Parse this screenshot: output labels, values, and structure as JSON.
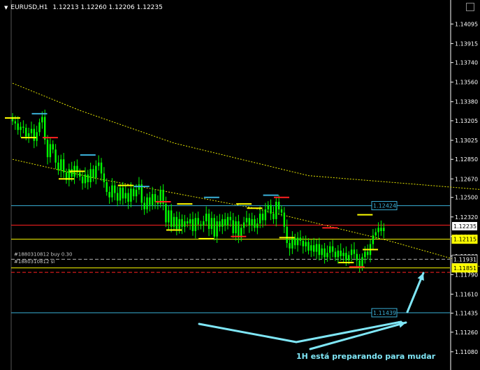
{
  "header": {
    "symbol": "EURUSD,H1",
    "ohlc": "1.12213 1.12260 1.12206 1.12235"
  },
  "caption": "1H está preparando para mudar",
  "colors": {
    "background": "#000000",
    "candle": "#00ff00",
    "level_cyan": "#3ab0d8",
    "level_yellow": "#ffff00",
    "level_red": "#ff2020",
    "bollinger": "#e6e600",
    "arrow": "#7fe6f6",
    "buy_line": "#9a9a9a"
  },
  "chart_data": {
    "type": "candlestick",
    "instrument": "EURUSD",
    "timeframe": "H1",
    "ylim": [
      1.10925,
      1.142
    ],
    "y_ticks": [
      "1.14095",
      "1.13915",
      "1.13740",
      "1.13560",
      "1.13380",
      "1.13205",
      "1.13025",
      "1.12850",
      "1.12670",
      "1.12500",
      "1.12320",
      "1.12140",
      "1.11960",
      "1.11790",
      "1.11610",
      "1.11435",
      "1.11260",
      "1.11080"
    ],
    "closes": [
      1.132,
      1.1318,
      1.1312,
      1.1315,
      1.1314,
      1.1306,
      1.1309,
      1.1313,
      1.1302,
      1.131,
      1.1319,
      1.1324,
      1.1303,
      1.1287,
      1.1299,
      1.1294,
      1.1282,
      1.1275,
      1.1285,
      1.1273,
      1.1266,
      1.1276,
      1.1269,
      1.1279,
      1.1273,
      1.1269,
      1.1263,
      1.1271,
      1.1264,
      1.1276,
      1.1268,
      1.1279,
      1.1282,
      1.1272,
      1.1264,
      1.1255,
      1.125,
      1.1261,
      1.1254,
      1.1247,
      1.1259,
      1.1249,
      1.1254,
      1.1246,
      1.1258,
      1.1251,
      1.1257,
      1.1262,
      1.1245,
      1.1239,
      1.125,
      1.1243,
      1.1253,
      1.1246,
      1.1244,
      1.1257,
      1.1244,
      1.1227,
      1.1238,
      1.1223,
      1.1232,
      1.1221,
      1.123,
      1.1223,
      1.1228,
      1.1226,
      1.123,
      1.1219,
      1.1231,
      1.1225,
      1.1224,
      1.1228,
      1.1235,
      1.1221,
      1.1231,
      1.1214,
      1.1228,
      1.1223,
      1.123,
      1.1224,
      1.1232,
      1.1229,
      1.1217,
      1.1228,
      1.1213,
      1.1222,
      1.1227,
      1.1231,
      1.1224,
      1.123,
      1.1222,
      1.1226,
      1.1235,
      1.1229,
      1.1239,
      1.1243,
      1.1235,
      1.123,
      1.1246,
      1.1239,
      1.1236,
      1.1223,
      1.1208,
      1.1203,
      1.1213,
      1.1206,
      1.1213,
      1.121,
      1.1205,
      1.1209,
      1.1201,
      1.1206,
      1.12,
      1.1207,
      1.1197,
      1.1203,
      1.1195,
      1.1199,
      1.1205,
      1.12,
      1.1195,
      1.1201,
      1.1196,
      1.1199,
      1.1192,
      1.1197,
      1.1202,
      1.1198,
      1.1192,
      1.1186,
      1.1195,
      1.12,
      1.1197,
      1.1207,
      1.1215,
      1.1218,
      1.1222,
      1.1219,
      1.1222
    ],
    "bollinger_upper": [
      [
        0,
        1.1355
      ],
      [
        25,
        1.133
      ],
      [
        60,
        1.13
      ],
      [
        110,
        1.127
      ],
      [
        150,
        1.1262
      ],
      [
        200,
        1.1252
      ],
      [
        240,
        1.1249
      ],
      [
        290,
        1.1247
      ],
      [
        330,
        1.125
      ],
      [
        370,
        1.1255
      ],
      [
        420,
        1.1249
      ],
      [
        480,
        1.1244
      ],
      [
        520,
        1.1244
      ]
    ],
    "bollinger_lower": [
      [
        0,
        1.1285
      ],
      [
        30,
        1.1268
      ],
      [
        90,
        1.124
      ],
      [
        140,
        1.121
      ],
      [
        190,
        1.1175
      ],
      [
        240,
        1.1145
      ],
      [
        290,
        1.113
      ],
      [
        340,
        1.1126
      ],
      [
        390,
        1.1122
      ],
      [
        440,
        1.112
      ],
      [
        490,
        1.1124
      ],
      [
        520,
        1.1134
      ]
    ],
    "bollinger_mid": [
      [
        280,
        1.12
      ],
      [
        300,
        1.1193
      ],
      [
        340,
        1.1187
      ],
      [
        380,
        1.1187
      ],
      [
        430,
        1.1187
      ],
      [
        470,
        1.1188
      ],
      [
        520,
        1.1191
      ]
    ],
    "hlines": [
      {
        "price": 1.12424,
        "color": "#3ab0d8",
        "label": "1.12424",
        "dash": false
      },
      {
        "price": 1.12245,
        "color": "#ff2020",
        "label": "",
        "dash": false
      },
      {
        "price": 1.12115,
        "color": "#ffff00",
        "label": "1.12115",
        "dash": false
      },
      {
        "price": 1.11931,
        "color": "#b0b0b0",
        "label": "1.11931",
        "dash": true
      },
      {
        "price": 1.11851,
        "color": "#ffff00",
        "label": "1.11851",
        "dash": false
      },
      {
        "price": 1.1181,
        "color": "#ff2020",
        "label": "",
        "dash": true
      },
      {
        "price": 1.11439,
        "color": "#3ab0d8",
        "label": "1.11439",
        "dash": false
      }
    ],
    "current_price": "1.12235",
    "orders": [
      {
        "text": "#1880310812 buy 0.30",
        "price": 1.11931
      },
      {
        "text": "#1880310812 sl",
        "price": 1.11851
      }
    ],
    "swing_marks": [
      {
        "i": 0,
        "p": 1.1323,
        "c": "#ffff00"
      },
      {
        "i": 10,
        "p": 1.1327,
        "c": "#3ab0d8"
      },
      {
        "i": 14,
        "p": 1.1305,
        "c": "#ff2020"
      },
      {
        "i": 6,
        "p": 1.1305,
        "c": "#ffff00"
      },
      {
        "i": 28,
        "p": 1.1289,
        "c": "#3ab0d8"
      },
      {
        "i": 24,
        "p": 1.1274,
        "c": "#ffff00"
      },
      {
        "i": 20,
        "p": 1.1267,
        "c": "#ffff00"
      },
      {
        "i": 42,
        "p": 1.1261,
        "c": "#ffff00"
      },
      {
        "i": 48,
        "p": 1.126,
        "c": "#3ab0d8"
      },
      {
        "i": 56,
        "p": 1.1246,
        "c": "#ff2020"
      },
      {
        "i": 60,
        "p": 1.122,
        "c": "#ffff00"
      },
      {
        "i": 64,
        "p": 1.1244,
        "c": "#ffff00"
      },
      {
        "i": 74,
        "p": 1.125,
        "c": "#3ab0d8"
      },
      {
        "i": 72,
        "p": 1.1212,
        "c": "#ffff00"
      },
      {
        "i": 84,
        "p": 1.1214,
        "c": "#ff2020"
      },
      {
        "i": 86,
        "p": 1.1244,
        "c": "#ffff00"
      },
      {
        "i": 90,
        "p": 1.124,
        "c": "#ffff00"
      },
      {
        "i": 96,
        "p": 1.1252,
        "c": "#3ab0d8"
      },
      {
        "i": 102,
        "p": 1.1213,
        "c": "#ffff00"
      },
      {
        "i": 100,
        "p": 1.125,
        "c": "#ff2020"
      },
      {
        "i": 118,
        "p": 1.1222,
        "c": "#ff2020"
      },
      {
        "i": 124,
        "p": 1.119,
        "c": "#ffff00"
      },
      {
        "i": 128,
        "p": 1.1186,
        "c": "#ff2020"
      },
      {
        "i": 131,
        "p": 1.1234,
        "c": "#ffff00"
      },
      {
        "i": 133,
        "p": 1.1202,
        "c": "#ffff00"
      }
    ],
    "arrows": [
      {
        "from": [
          285,
          464
        ],
        "to": [
          424,
          490
        ],
        "head": false
      },
      {
        "from": [
          424,
          490
        ],
        "to": [
          574,
          461
        ],
        "head": false
      },
      {
        "from": [
          444,
          500
        ],
        "to": [
          581,
          462
        ],
        "head": true
      },
      {
        "from": [
          583,
          447
        ],
        "to": [
          606,
          391
        ],
        "head": true
      }
    ]
  }
}
